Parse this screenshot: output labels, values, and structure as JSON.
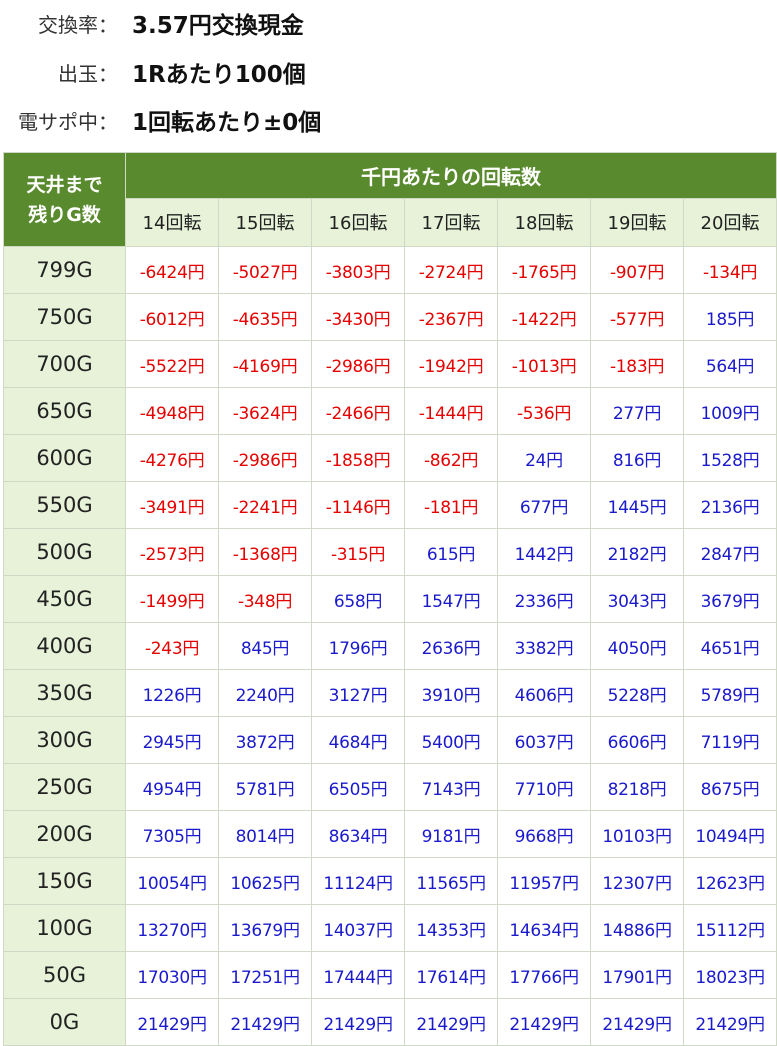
{
  "info": [
    {
      "label": "交換率：",
      "value": "3.57円交換現金"
    },
    {
      "label": "出玉：",
      "value": "1Rあたり100個"
    },
    {
      "label": "電サポ中：",
      "value": "1回転あたり±0個"
    }
  ],
  "table": {
    "corner_line1": "天井まで",
    "corner_line2": "残りG数",
    "group_header": "千円あたりの回転数",
    "columns": [
      "14回転",
      "15回転",
      "16回転",
      "17回転",
      "18回転",
      "19回転",
      "20回転"
    ],
    "rows": [
      {
        "label": "799G",
        "values": [
          "-6424円",
          "-5027円",
          "-3803円",
          "-2724円",
          "-1765円",
          "-907円",
          "-134円"
        ]
      },
      {
        "label": "750G",
        "values": [
          "-6012円",
          "-4635円",
          "-3430円",
          "-2367円",
          "-1422円",
          "-577円",
          "185円"
        ]
      },
      {
        "label": "700G",
        "values": [
          "-5522円",
          "-4169円",
          "-2986円",
          "-1942円",
          "-1013円",
          "-183円",
          "564円"
        ]
      },
      {
        "label": "650G",
        "values": [
          "-4948円",
          "-3624円",
          "-2466円",
          "-1444円",
          "-536円",
          "277円",
          "1009円"
        ]
      },
      {
        "label": "600G",
        "values": [
          "-4276円",
          "-2986円",
          "-1858円",
          "-862円",
          "24円",
          "816円",
          "1528円"
        ]
      },
      {
        "label": "550G",
        "values": [
          "-3491円",
          "-2241円",
          "-1146円",
          "-181円",
          "677円",
          "1445円",
          "2136円"
        ]
      },
      {
        "label": "500G",
        "values": [
          "-2573円",
          "-1368円",
          "-315円",
          "615円",
          "1442円",
          "2182円",
          "2847円"
        ]
      },
      {
        "label": "450G",
        "values": [
          "-1499円",
          "-348円",
          "658円",
          "1547円",
          "2336円",
          "3043円",
          "3679円"
        ]
      },
      {
        "label": "400G",
        "values": [
          "-243円",
          "845円",
          "1796円",
          "2636円",
          "3382円",
          "4050円",
          "4651円"
        ]
      },
      {
        "label": "350G",
        "values": [
          "1226円",
          "2240円",
          "3127円",
          "3910円",
          "4606円",
          "5228円",
          "5789円"
        ]
      },
      {
        "label": "300G",
        "values": [
          "2945円",
          "3872円",
          "4684円",
          "5400円",
          "6037円",
          "6606円",
          "7119円"
        ]
      },
      {
        "label": "250G",
        "values": [
          "4954円",
          "5781円",
          "6505円",
          "7143円",
          "7710円",
          "8218円",
          "8675円"
        ]
      },
      {
        "label": "200G",
        "values": [
          "7305円",
          "8014円",
          "8634円",
          "9181円",
          "9668円",
          "10103円",
          "10494円"
        ]
      },
      {
        "label": "150G",
        "values": [
          "10054円",
          "10625円",
          "11124円",
          "11565円",
          "11957円",
          "12307円",
          "12623円"
        ]
      },
      {
        "label": "100G",
        "values": [
          "13270円",
          "13679円",
          "14037円",
          "14353円",
          "14634円",
          "14886円",
          "15112円"
        ]
      },
      {
        "label": "50G",
        "values": [
          "17030円",
          "17251円",
          "17444円",
          "17614円",
          "17766円",
          "17901円",
          "18023円"
        ]
      },
      {
        "label": "0G",
        "values": [
          "21429円",
          "21429円",
          "21429円",
          "21429円",
          "21429円",
          "21429円",
          "21429円"
        ]
      }
    ]
  },
  "colors": {
    "header_green": "#5a8a2e",
    "light_green": "#e7f2d9",
    "negative": "#e60000",
    "positive": "#1a1acc"
  }
}
